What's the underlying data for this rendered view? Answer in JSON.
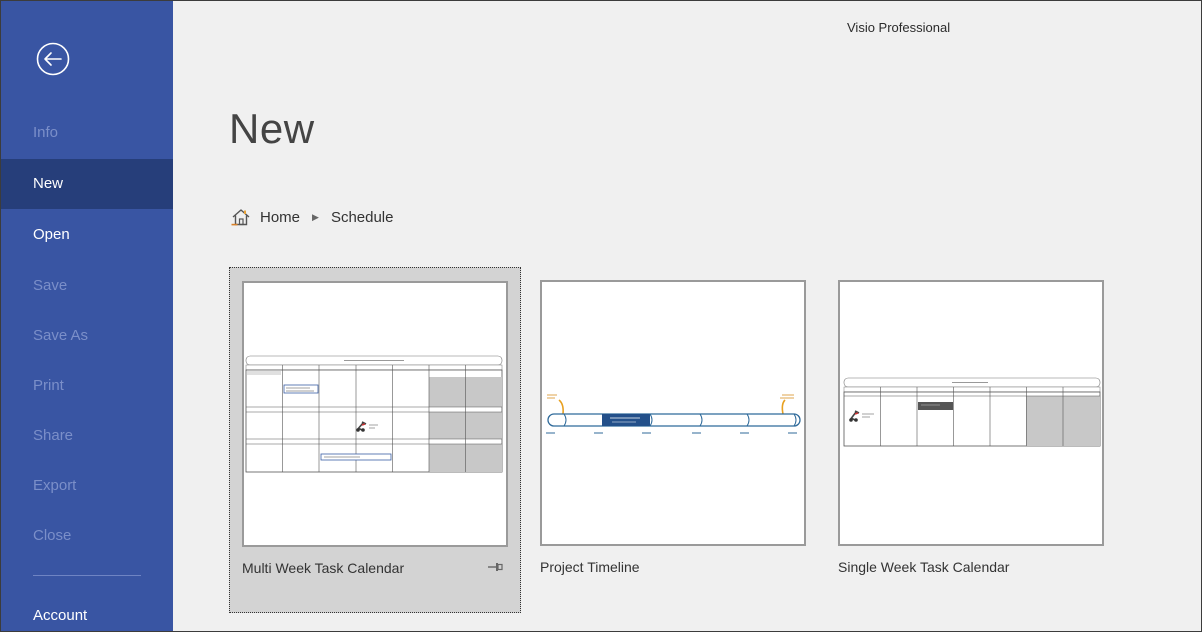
{
  "app": {
    "title": "Visio Professional"
  },
  "sidebar": {
    "back_icon": "back-arrow-icon",
    "items": [
      {
        "label": "Info",
        "state": "disabled"
      },
      {
        "label": "New",
        "state": "selected"
      },
      {
        "label": "Open",
        "state": "enabled"
      },
      {
        "label": "Save",
        "state": "disabled"
      },
      {
        "label": "Save As",
        "state": "disabled"
      },
      {
        "label": "Print",
        "state": "disabled"
      },
      {
        "label": "Share",
        "state": "disabled"
      },
      {
        "label": "Export",
        "state": "disabled"
      },
      {
        "label": "Close",
        "state": "disabled"
      },
      {
        "label": "Account",
        "state": "enabled"
      }
    ],
    "colors": {
      "background": "#3955a3",
      "selected": "#263e7a",
      "disabled_text": "#7b8fc9"
    }
  },
  "page": {
    "title": "New"
  },
  "breadcrumb": {
    "home_icon": "home-icon",
    "home_label": "Home",
    "separator_icon": "triangle-right-icon",
    "current": "Schedule"
  },
  "templates": [
    {
      "label": "Multi Week Task Calendar",
      "selected": true,
      "pin_icon": "pin-icon"
    },
    {
      "label": "Project Timeline",
      "selected": false
    },
    {
      "label": "Single Week Task Calendar",
      "selected": false
    }
  ]
}
